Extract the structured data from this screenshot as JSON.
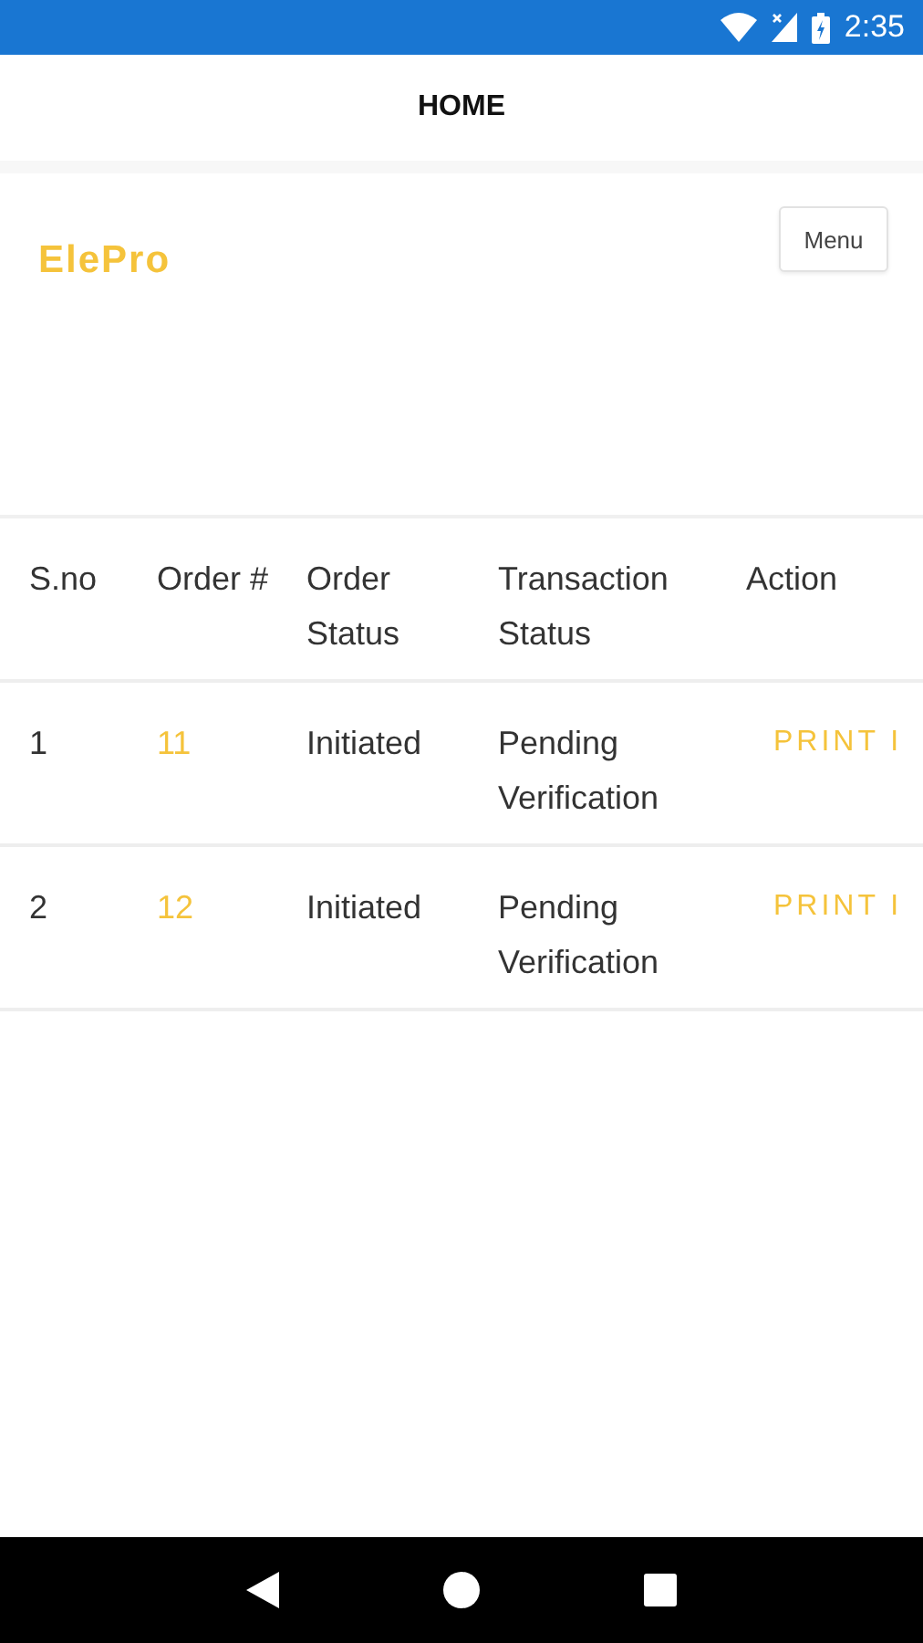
{
  "status_bar": {
    "time": "2:35"
  },
  "app_bar": {
    "title": "HOME"
  },
  "brand": "ElePro",
  "menu_button": "Menu",
  "table": {
    "columns": [
      "S.no",
      "Order #",
      "Order Status",
      "Transaction Status",
      "Action"
    ],
    "rows": [
      {
        "sno": "1",
        "order": "11",
        "order_status": "Initiated",
        "transaction_status": "Pending Verification",
        "action": "PRINT I"
      },
      {
        "sno": "2",
        "order": "12",
        "order_status": "Initiated",
        "transaction_status": "Pending Verification",
        "action": "PRINT I"
      }
    ]
  }
}
